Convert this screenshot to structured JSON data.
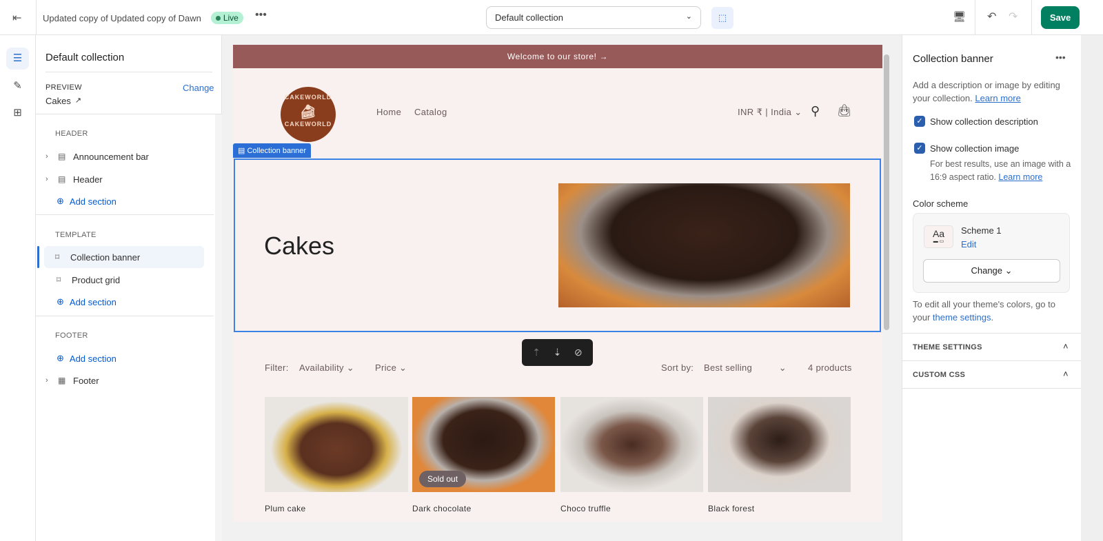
{
  "topbar": {
    "theme_name": "Updated copy of Updated copy of Dawn",
    "status": "Live",
    "more_icon": "more-horizontal-icon",
    "template_select": "Default collection",
    "save_label": "Save"
  },
  "left_panel": {
    "title": "Default collection",
    "preview_label": "PREVIEW",
    "preview_value": "Cakes",
    "change_label": "Change",
    "groups": [
      {
        "label": "HEADER",
        "items": [
          "Announcement bar",
          "Header"
        ],
        "add": "Add section"
      },
      {
        "label": "TEMPLATE",
        "items": [
          "Collection banner",
          "Product grid"
        ],
        "add": "Add section"
      },
      {
        "label": "FOOTER",
        "items": [
          "Footer"
        ],
        "add": "Add section"
      }
    ]
  },
  "preview": {
    "announcement": "Welcome to our store!",
    "logo_text": "CAKEWORLD",
    "nav": [
      "Home",
      "Catalog"
    ],
    "currency": "INR ₹ | India",
    "section_tag": "Collection banner",
    "collection_title": "Cakes",
    "filter_label": "Filter:",
    "filters": [
      "Availability",
      "Price"
    ],
    "sort_label": "Sort by:",
    "sort_value": "Best selling",
    "product_count": "4 products",
    "products": [
      {
        "name": "Plum cake",
        "badge": ""
      },
      {
        "name": "Dark chocolate",
        "badge": "Sold out"
      },
      {
        "name": "Choco truffle",
        "badge": ""
      },
      {
        "name": "Black forest",
        "badge": ""
      }
    ],
    "colors": {
      "announcement_bg": "#985a59",
      "page_bg": "#f8f1f0",
      "selection": "#3b82e6"
    }
  },
  "right_panel": {
    "title": "Collection banner",
    "description": "Add a description or image by editing your collection.",
    "learn_more": "Learn more",
    "show_description": {
      "label": "Show collection description",
      "checked": true
    },
    "show_image": {
      "label": "Show collection image",
      "checked": true,
      "help": "For best results, use an image with a 16:9 aspect ratio.",
      "link": "Learn more"
    },
    "color_scheme_label": "Color scheme",
    "scheme_preview": "Aa",
    "scheme_name": "Scheme 1",
    "edit_label": "Edit",
    "change_label": "Change",
    "theme_help": "To edit all your theme's colors, go to your",
    "theme_link": "theme settings",
    "accordions": [
      "THEME SETTINGS",
      "CUSTOM CSS"
    ]
  }
}
